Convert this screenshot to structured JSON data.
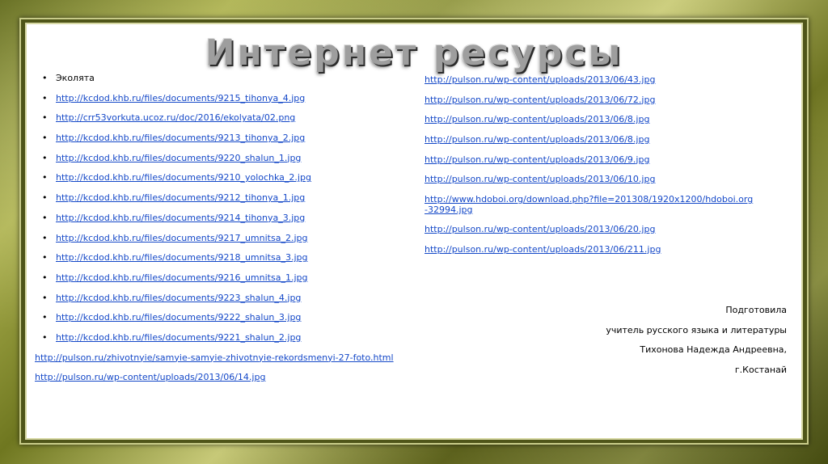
{
  "title": "Интернет ресурсы",
  "left_bullets": [
    "Эколята",
    "http://kcdod.khb.ru/files/documents/9215_tihonya_4.jpg",
    "http://crr53vorkuta.ucoz.ru/doc/2016/ekolyata/02.png",
    "http://kcdod.khb.ru/files/documents/9213_tihonya_2.jpg",
    "http://kcdod.khb.ru/files/documents/9220_shalun_1.jpg",
    "http://kcdod.khb.ru/files/documents/9210_yolochka_2.jpg",
    "http://kcdod.khb.ru/files/documents/9212_tihonya_1.jpg",
    "http://kcdod.khb.ru/files/documents/9214_tihonya_3.jpg",
    "http://kcdod.khb.ru/files/documents/9217_umnitsa_2.jpg",
    "http://kcdod.khb.ru/files/documents/9218_umnitsa_3.jpg",
    "http://kcdod.khb.ru/files/documents/9216_umnitsa_1.jpg",
    "http://kcdod.khb.ru/files/documents/9223_shalun_4.jpg",
    "http://kcdod.khb.ru/files/documents/9222_shalun_3.jpg",
    "http://kcdod.khb.ru/files/documents/9221_shalun_2.jpg"
  ],
  "left_plain": [
    "http://pulson.ru/zhivotnyie/samyie-samyie-zhivotnyie-rekordsmenyi-27-foto.html",
    "http://pulson.ru/wp-content/uploads/2013/06/14.jpg"
  ],
  "right_links": [
    "http://pulson.ru/wp-content/uploads/2013/06/43.jpg",
    "http://pulson.ru/wp-content/uploads/2013/06/72.jpg",
    "http://pulson.ru/wp-content/uploads/2013/06/8.jpg",
    "http://pulson.ru/wp-content/uploads/2013/06/8.jpg",
    "http://pulson.ru/wp-content/uploads/2013/06/9.jpg",
    "http://pulson.ru/wp-content/uploads/2013/06/10.jpg",
    "http://www.hdoboi.org/download.php?file=201308/1920x1200/hdoboi.org-32994.jpg",
    "http://pulson.ru/wp-content/uploads/2013/06/20.jpg",
    "http://pulson.ru/wp-content/uploads/2013/06/211.jpg"
  ],
  "signature": {
    "line1": "Подготовила",
    "line2": "учитель русского языка и литературы",
    "line3": "Тихонова Надежда Андреевна,",
    "line4": "г.Костанай"
  },
  "colors": {
    "link": "#1448c8",
    "frame": "#7a8227",
    "background": "#ffffff"
  }
}
